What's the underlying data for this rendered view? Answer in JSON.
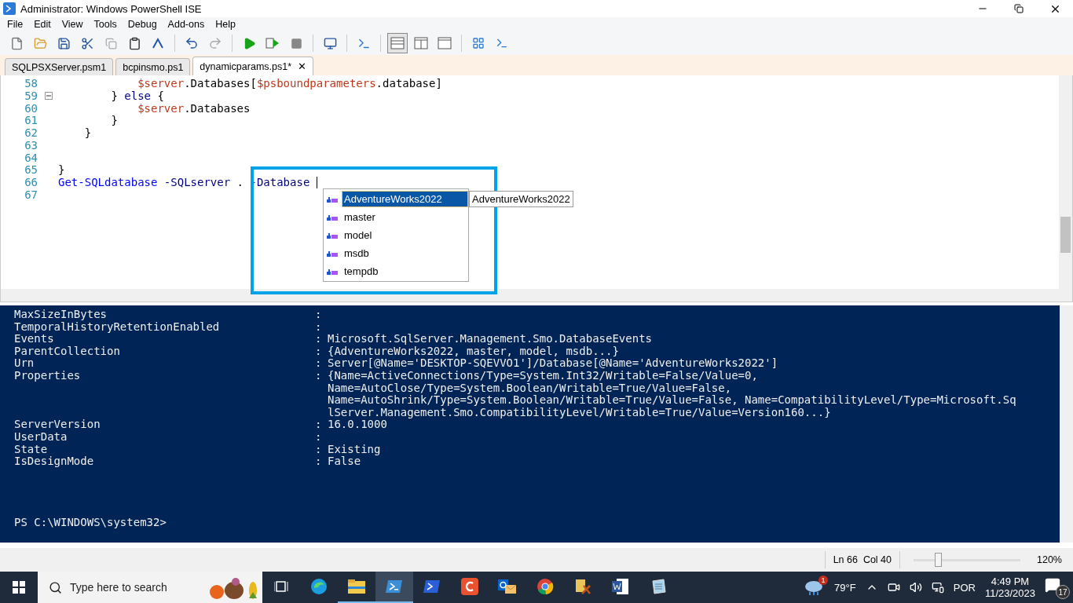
{
  "window": {
    "title": "Administrator: Windows PowerShell ISE"
  },
  "menu": [
    "File",
    "Edit",
    "View",
    "Tools",
    "Debug",
    "Add-ons",
    "Help"
  ],
  "tabs": [
    {
      "label": "SQLPSXServer.psm1",
      "selected": false
    },
    {
      "label": "bcpinsmo.ps1",
      "selected": false
    },
    {
      "label": "dynamicparams.ps1*",
      "selected": true,
      "close": "✕"
    }
  ],
  "editor": {
    "lines": [
      {
        "number": "58",
        "collapsible": false,
        "cursor": false,
        "tokens": [
          {
            "kind": "variable",
            "text": "            $server"
          },
          {
            "kind": "plain",
            "text": ".Databases["
          },
          {
            "kind": "variable",
            "text": "$psboundparameters"
          },
          {
            "kind": "plain",
            "text": ".database]"
          }
        ]
      },
      {
        "number": "59",
        "collapsible": true,
        "cursor": false,
        "tokens": [
          {
            "kind": "plain",
            "text": "        } "
          },
          {
            "kind": "keyword",
            "text": "else"
          },
          {
            "kind": "plain",
            "text": " {"
          }
        ]
      },
      {
        "number": "60",
        "collapsible": false,
        "cursor": false,
        "tokens": [
          {
            "kind": "variable",
            "text": "            $server"
          },
          {
            "kind": "plain",
            "text": ".Databases"
          }
        ]
      },
      {
        "number": "61",
        "collapsible": false,
        "cursor": false,
        "tokens": [
          {
            "kind": "plain",
            "text": "        }"
          }
        ]
      },
      {
        "number": "62",
        "collapsible": false,
        "cursor": false,
        "tokens": [
          {
            "kind": "plain",
            "text": "    }"
          }
        ]
      },
      {
        "number": "63",
        "collapsible": false,
        "cursor": false
      },
      {
        "number": "64",
        "collapsible": false,
        "cursor": false
      },
      {
        "number": "65",
        "collapsible": false,
        "cursor": false,
        "tokens": [
          {
            "kind": "plain",
            "text": "}"
          }
        ]
      },
      {
        "number": "66",
        "collapsible": false,
        "cursor": true,
        "tokens": [
          {
            "kind": "command",
            "text": "Get-SQLdatabase"
          },
          {
            "kind": "parameter",
            "text": " -SQLserver"
          },
          {
            "kind": "plain",
            "text": " . "
          },
          {
            "kind": "parameter",
            "text": "-Database "
          }
        ]
      },
      {
        "number": "67",
        "collapsible": false,
        "cursor": false
      }
    ],
    "completion": {
      "items": [
        {
          "label": "AdventureWorks2022",
          "selected": true
        },
        {
          "label": "master",
          "selected": false
        },
        {
          "label": "model",
          "selected": false
        },
        {
          "label": "msdb",
          "selected": false
        },
        {
          "label": "tempdb",
          "selected": false
        }
      ],
      "tooltip": "AdventureWorks2022"
    }
  },
  "console": {
    "rows": [
      {
        "name": "MaxSizeInBytes",
        "separator": ":"
      },
      {
        "name": "TemporalHistoryRetentionEnabled",
        "separator": ":"
      },
      {
        "name": "Events",
        "separator": ":",
        "value": [
          "Microsoft.SqlServer.Management.Smo.DatabaseEvents"
        ]
      },
      {
        "name": "ParentCollection",
        "separator": ":",
        "value": [
          "{AdventureWorks2022, master, model, msdb...}"
        ]
      },
      {
        "name": "Urn",
        "separator": ":",
        "value": [
          "Server[@Name='DESKTOP-SQEVVO1']/Database[@Name='AdventureWorks2022']"
        ]
      },
      {
        "name": "Properties",
        "separator": ":",
        "value": [
          "{Name=ActiveConnections/Type=System.Int32/Writable=False/Value=0,",
          "Name=AutoClose/Type=System.Boolean/Writable=True/Value=False,",
          "Name=AutoShrink/Type=System.Boolean/Writable=True/Value=False, Name=CompatibilityLevel/Type=Microsoft.Sq",
          "lServer.Management.Smo.CompatibilityLevel/Writable=True/Value=Version160...}"
        ]
      },
      {
        "name": "ServerVersion",
        "separator": ":",
        "value": [
          "16.0.1000"
        ]
      },
      {
        "name": "UserData",
        "separator": ":"
      },
      {
        "name": "State",
        "separator": ":",
        "value": [
          "Existing"
        ]
      },
      {
        "name": "IsDesignMode",
        "separator": ":",
        "value": [
          "False"
        ]
      }
    ],
    "prompt": "PS C:\\WINDOWS\\system32>"
  },
  "status_bar": {
    "position": "Ln 66  Col 40",
    "zoom": {
      "level": 0.22
    },
    "zoom_label": "120%"
  },
  "taskbar": {
    "search": {
      "placeholder": "Type here to search"
    },
    "weather": {
      "temperature": "79°F",
      "badge": "1"
    },
    "language": "POR",
    "time": "4:49 PM",
    "date": "11/23/2023",
    "notifications": "17"
  }
}
